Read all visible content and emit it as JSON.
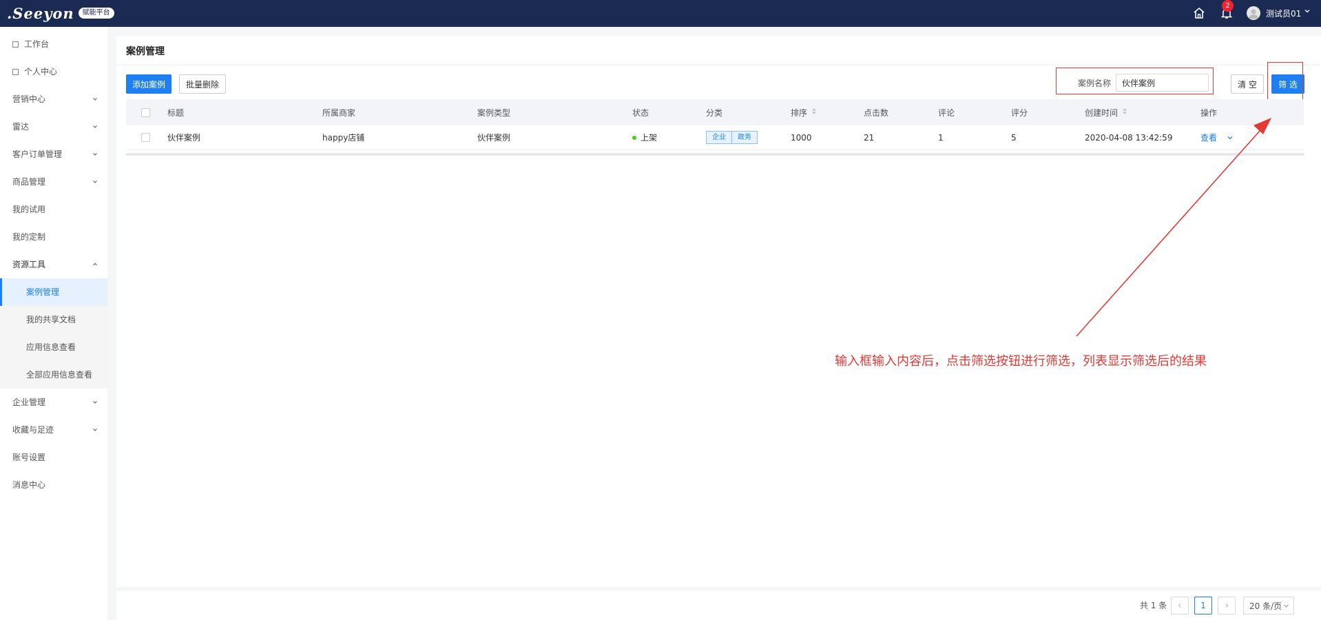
{
  "topbar": {
    "logo_text": ".Seeyon",
    "logo_badge": "赋能平台",
    "notification_count": "2",
    "username": "测试员01",
    "icons": [
      "home-icon",
      "bell-icon",
      "avatar",
      "chevron-down-icon"
    ]
  },
  "sidebar": {
    "items": [
      {
        "label": "工作台"
      },
      {
        "label": "个人中心"
      },
      {
        "label": "营销中心"
      },
      {
        "label": "雷达"
      },
      {
        "label": "客户订单管理"
      },
      {
        "label": "商品管理"
      },
      {
        "label": "我的试用"
      },
      {
        "label": "我的定制"
      },
      {
        "label": "资源工具"
      },
      {
        "label": "案例管理"
      },
      {
        "label": "我的共享文档"
      },
      {
        "label": "应用信息查看"
      },
      {
        "label": "全部应用信息查看"
      },
      {
        "label": "企业管理"
      },
      {
        "label": "收藏与足迹"
      },
      {
        "label": "账号设置"
      },
      {
        "label": "消息中心"
      }
    ]
  },
  "main": {
    "title": "案例管理",
    "add_button": "添加案例",
    "batch_delete_button": "批量删除",
    "filter": {
      "label": "案例名称",
      "value": "伙伴案例",
      "clear_button": "清 空",
      "filter_button": "筛 选"
    },
    "table": {
      "headers": [
        "标题",
        "所属商家",
        "案例类型",
        "状态",
        "分类",
        "排序",
        "点击数",
        "评论",
        "评分",
        "创建时间",
        "操作"
      ],
      "rows": [
        {
          "title": "伙伴案例",
          "merchant": "happy店铺",
          "type": "伙伴案例",
          "status": "上架",
          "tags": [
            "企业",
            "政务"
          ],
          "sort": "1000",
          "clicks": "21",
          "comments": "1",
          "score": "5",
          "created": "2020-04-08 13:42:59",
          "action": "查看"
        }
      ]
    }
  },
  "annotation": {
    "text": "输入框输入内容后，点击筛选按钮进行筛选，列表显示筛选后的结果",
    "color": "#e53935"
  },
  "pagination": {
    "total": "共 1 条",
    "current_page": "1",
    "page_size": "20 条/页"
  },
  "colors": {
    "topbar": "#1b2a52",
    "primary": "#1d7ff0",
    "annotation": "#e53935",
    "status_online": "#52c41a"
  }
}
